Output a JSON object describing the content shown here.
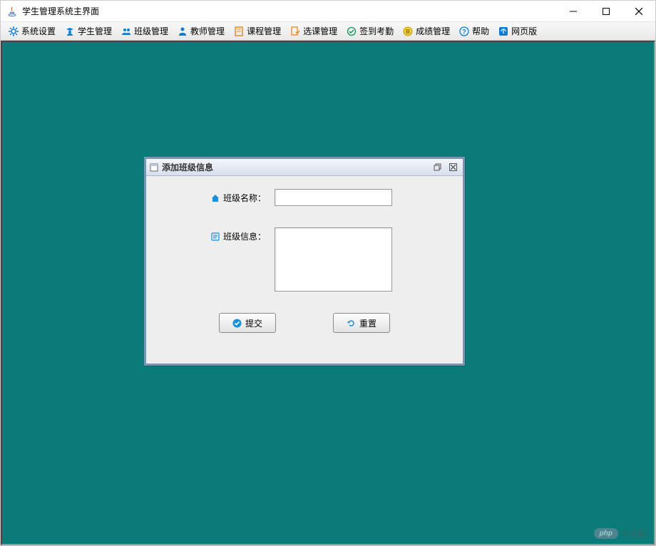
{
  "window": {
    "title": "学生管理系统主界面"
  },
  "toolbar": {
    "items": [
      {
        "label": "系统设置",
        "icon": "gear-icon",
        "color": "#0b7dd6"
      },
      {
        "label": "学生管理",
        "icon": "student-icon",
        "color": "#0b7dd6"
      },
      {
        "label": "班级管理",
        "icon": "class-icon",
        "color": "#0b7dd6"
      },
      {
        "label": "教师管理",
        "icon": "teacher-icon",
        "color": "#0b7dd6"
      },
      {
        "label": "课程管理",
        "icon": "course-icon",
        "color": "#e28b2d"
      },
      {
        "label": "选课管理",
        "icon": "select-course-icon",
        "color": "#e28b2d"
      },
      {
        "label": "签到考勤",
        "icon": "attendance-icon",
        "color": "#0b9a5a"
      },
      {
        "label": "成绩管理",
        "icon": "grade-icon",
        "color": "#e5b700"
      },
      {
        "label": "帮助",
        "icon": "help-icon",
        "color": "#0b7dd6"
      },
      {
        "label": "网页版",
        "icon": "web-icon",
        "color": "#0b7dd6"
      }
    ]
  },
  "dialog": {
    "title": "添加班级信息",
    "fields": {
      "class_name": {
        "label": "班级名称：",
        "value": ""
      },
      "class_info": {
        "label": "班级信息：",
        "value": ""
      }
    },
    "buttons": {
      "submit": "提交",
      "reset": "重置"
    }
  },
  "watermark": {
    "badge": "php",
    "text": "中文网"
  }
}
